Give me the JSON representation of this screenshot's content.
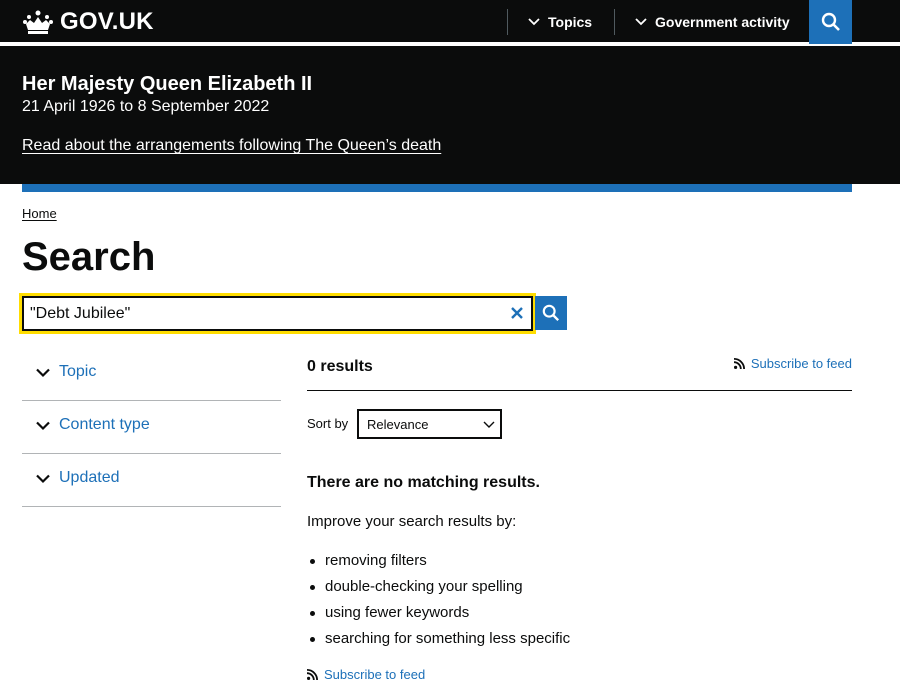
{
  "header": {
    "logo_text": "GOV.UK",
    "nav": [
      {
        "label": "Topics"
      },
      {
        "label": "Government activity"
      }
    ]
  },
  "banner": {
    "title": "Her Majesty Queen Elizabeth II",
    "dates": "21 April 1926 to 8 September 2022",
    "link": "Read about the arrangements following The Queen’s death"
  },
  "breadcrumb": {
    "home": "Home"
  },
  "page_title": "Search",
  "search": {
    "value": "\"Debt Jubilee\""
  },
  "filters": [
    {
      "label": "Topic"
    },
    {
      "label": "Content type"
    },
    {
      "label": "Updated"
    }
  ],
  "results": {
    "count": "0 results",
    "subscribe": "Subscribe to feed",
    "sort_label": "Sort by",
    "sort_value": "Relevance",
    "no_results": "There are no matching results.",
    "improve": "Improve your search results by:",
    "tips": [
      "removing filters",
      "double-checking your spelling",
      "using fewer keywords",
      "searching for something less specific"
    ],
    "subscribe_bottom": "Subscribe to feed"
  },
  "colors": {
    "header_bg": "#0b0c0c",
    "brand_blue": "#1d70b8",
    "focus_yellow": "#ffdd00"
  },
  "icons": {
    "logo": "crown-icon",
    "search": "search-icon",
    "clear": "close-icon",
    "chevron": "chevron-down-icon",
    "feed": "rss-icon"
  }
}
